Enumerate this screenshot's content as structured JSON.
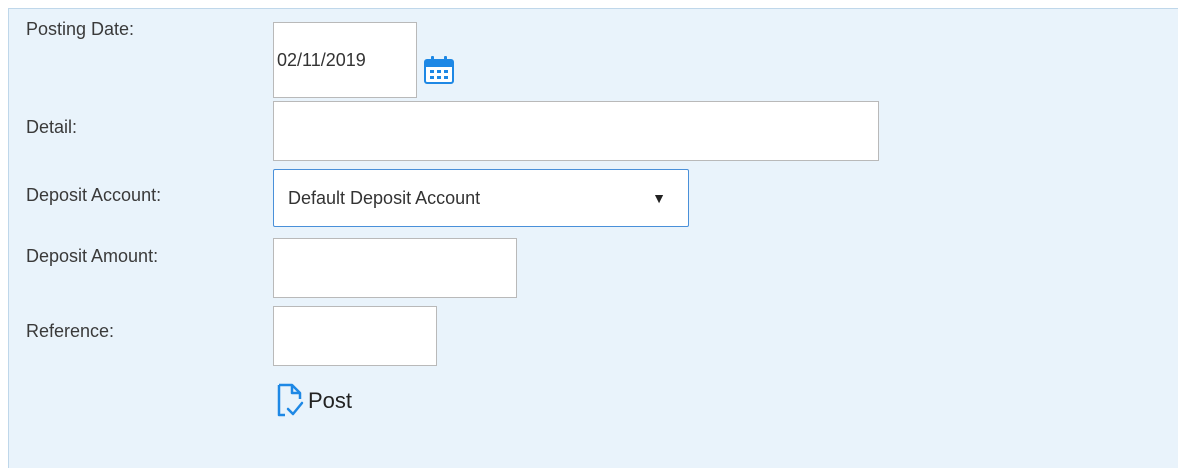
{
  "form": {
    "posting_date": {
      "label": "Posting Date:",
      "value": "02/11/2019"
    },
    "detail": {
      "label": "Detail:",
      "value": ""
    },
    "deposit_account": {
      "label": "Deposit Account:",
      "selected": "Default Deposit Account",
      "caret": "▼"
    },
    "deposit_amount": {
      "label": "Deposit Amount:",
      "value": ""
    },
    "reference": {
      "label": "Reference:",
      "value": ""
    },
    "post_button": {
      "label": "Post"
    }
  },
  "icons": {
    "calendar": "calendar-icon",
    "post": "document-check-icon"
  },
  "colors": {
    "panel_background": "#e9f3fb",
    "accent_blue": "#1e88e5",
    "select_border": "#4a90d9"
  }
}
